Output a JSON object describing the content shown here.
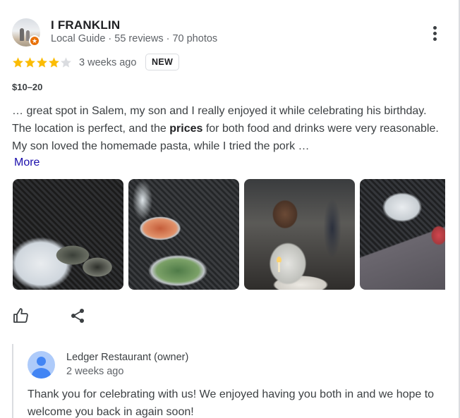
{
  "reviewer": {
    "name": "I FRANKLIN",
    "meta": "Local Guide · 55 reviews · 70 photos",
    "avatar_icon": "profile-photo",
    "badge_icon": "local-guide-star-icon",
    "badge_color": "#e8710a"
  },
  "rating": {
    "stars": 4,
    "max": 5,
    "star_color": "#fbbc04",
    "empty_star_color": "#dadce0",
    "time": "3 weeks ago",
    "badge": "NEW"
  },
  "price": "$10–20",
  "review": {
    "text_before": "… great spot in Salem, my son and I really enjoyed it while celebrating his birthday. The location is perfect, and the ",
    "highlight": "prices",
    "text_after": " for both food and drinks were very reasonable. My son loved the homemade pasta, while I tried the pork …",
    "more_label": "More"
  },
  "photos": [
    {
      "icon": "oysters-photo"
    },
    {
      "icon": "dishes-photo"
    },
    {
      "icon": "birthday-boy-photo"
    },
    {
      "icon": "cocktail-photo"
    }
  ],
  "actions": {
    "like_icon": "thumbs-up-icon",
    "share_icon": "share-icon"
  },
  "owner_reply": {
    "name": "Ledger Restaurant (owner)",
    "time": "2 weeks ago",
    "text": "Thank you for celebrating with us! We enjoyed having you both in and we hope to welcome you back in again soon!",
    "avatar_icon": "person-icon",
    "avatar_color": "#4285f4"
  }
}
